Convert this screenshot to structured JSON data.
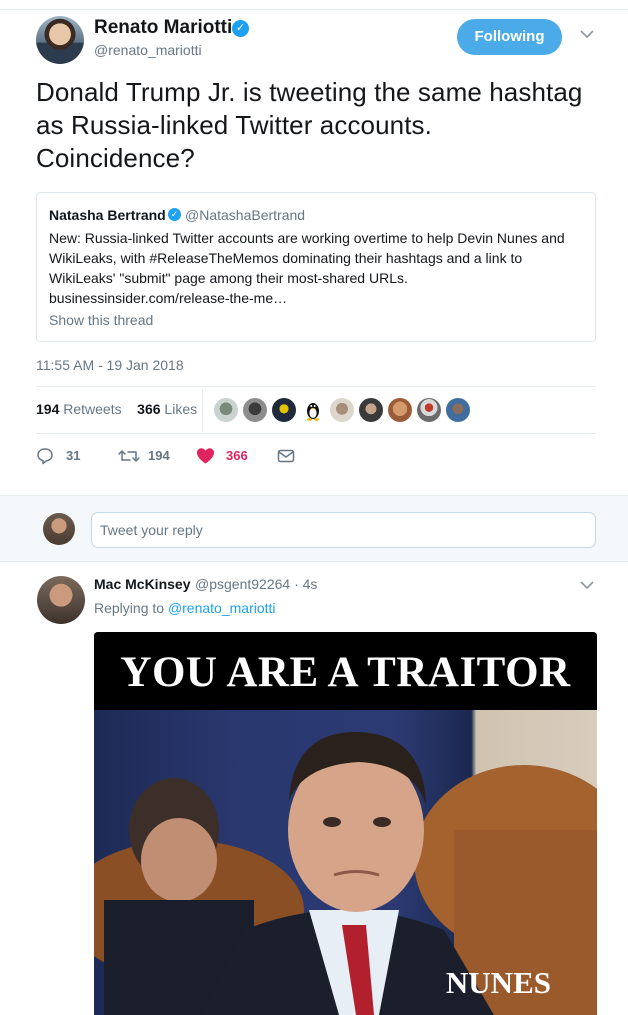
{
  "main_tweet": {
    "author_name": "Renato Mariotti",
    "author_handle": "@renato_mariotti",
    "follow_label": "Following",
    "text": "Donald Trump Jr. is tweeting the same hashtag as Russia-linked Twitter accounts. Coincidence?",
    "quote": {
      "author_name": "Natasha Bertrand",
      "author_handle": "@NatashaBertrand",
      "text": "New: Russia-linked Twitter accounts are working overtime to help Devin Nunes and WikiLeaks, with #ReleaseTheMemos dominating their hashtags and a link to WikiLeaks' \"submit\" page among their most-shared URLs. businessinsider.com/release-the-me…",
      "show_thread": "Show this thread"
    },
    "timestamp": "11:55 AM - 19 Jan 2018",
    "retweets_count": "194",
    "retweets_label": "Retweets",
    "likes_count": "366",
    "likes_label": "Likes",
    "actions": {
      "replies": "31",
      "retweets": "194",
      "likes": "366"
    }
  },
  "reply_box": {
    "placeholder": "Tweet your reply"
  },
  "reply_tweet": {
    "author_name": "Mac McKinsey",
    "author_handle": "@psgent92264 · 4s",
    "replying_prefix": "Replying to",
    "replying_to": "@renato_mariotti",
    "media_title": "YOU ARE A TRAITOR",
    "media_caption": "NUNES"
  },
  "colors": {
    "brand_blue": "#1da1f2",
    "follow_button": "#4aabe8",
    "like_red": "#e0245e",
    "muted_text": "#657786"
  }
}
